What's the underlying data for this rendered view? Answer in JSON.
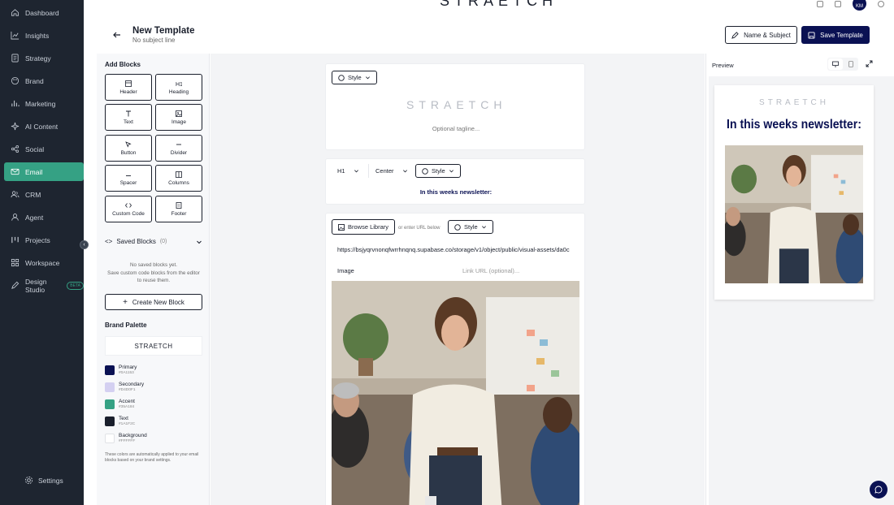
{
  "app": {
    "brand": "STRAETCH"
  },
  "sidebar": {
    "items": [
      {
        "label": "Dashboard",
        "icon": "home-icon"
      },
      {
        "label": "Insights",
        "icon": "chart-line-icon"
      },
      {
        "label": "Strategy",
        "icon": "document-icon"
      },
      {
        "label": "Brand",
        "icon": "palette-icon"
      },
      {
        "label": "Marketing",
        "icon": "bar-chart-icon"
      },
      {
        "label": "AI Content",
        "icon": "sparkle-icon"
      },
      {
        "label": "Social",
        "icon": "share-icon"
      },
      {
        "label": "Email",
        "icon": "mail-icon"
      },
      {
        "label": "CRM",
        "icon": "users-icon"
      },
      {
        "label": "Agent",
        "icon": "user-icon"
      },
      {
        "label": "Projects",
        "icon": "kanban-icon"
      },
      {
        "label": "Workspace",
        "icon": "grid-icon"
      },
      {
        "label": "Design Studio",
        "icon": "pen-icon",
        "badge": "BETA"
      }
    ],
    "active": "Email",
    "settings_label": "Settings"
  },
  "user": {
    "initials": "KM"
  },
  "header": {
    "title": "New Template",
    "subtitle": "No subject line",
    "name_subject_label": "Name & Subject",
    "save_label": "Save Template"
  },
  "add_blocks": {
    "title": "Add Blocks",
    "blocks": [
      {
        "label": "Header",
        "icon": "header-icon"
      },
      {
        "label": "Heading",
        "icon": "heading-icon"
      },
      {
        "label": "Text",
        "icon": "text-icon"
      },
      {
        "label": "Image",
        "icon": "image-icon"
      },
      {
        "label": "Button",
        "icon": "cursor-icon"
      },
      {
        "label": "Divider",
        "icon": "divider-icon"
      },
      {
        "label": "Spacer",
        "icon": "spacer-icon"
      },
      {
        "label": "Columns",
        "icon": "columns-icon"
      },
      {
        "label": "Custom Code",
        "icon": "code-icon"
      },
      {
        "label": "Footer",
        "icon": "footer-icon"
      }
    ]
  },
  "saved_blocks": {
    "title": "Saved Blocks",
    "count": "(0)",
    "empty_line1": "No saved blocks yet.",
    "empty_line2": "Save custom code blocks from the editor to reuse them.",
    "create_label": "Create New Block"
  },
  "brand_palette": {
    "title": "Brand Palette",
    "brand_name": "STRAETCH",
    "colors": [
      {
        "name": "Primary",
        "hex": "#0A1153"
      },
      {
        "name": "Secondary",
        "hex": "#D4D0F1"
      },
      {
        "name": "Accent",
        "hex": "#35A184"
      },
      {
        "name": "Text",
        "hex": "#1A1F2C"
      },
      {
        "name": "Background",
        "hex": "#FFFFFF"
      }
    ],
    "note": "These colors are automatically applied to your email blocks based on your brand settings."
  },
  "canvas": {
    "header_block": {
      "style_label": "Style",
      "brand": "STRAETCH",
      "tagline": "Optional tagline..."
    },
    "heading_block": {
      "level": "H1",
      "align": "Center",
      "style_label": "Style",
      "text": "In this weeks newsletter:"
    },
    "image_block": {
      "browse_label": "Browse Library",
      "or_label": "or enter URL below",
      "style_label": "Style",
      "url": "https://bsjyqrvnonqfwrrhnqnq.supabase.co/storage/v1/object/public/visual-assets/da0c",
      "image_label": "Image",
      "link_placeholder": "Link URL (optional)..."
    }
  },
  "preview": {
    "title": "Preview",
    "brand": "STRAETCH",
    "heading": "In this weeks newsletter:"
  }
}
